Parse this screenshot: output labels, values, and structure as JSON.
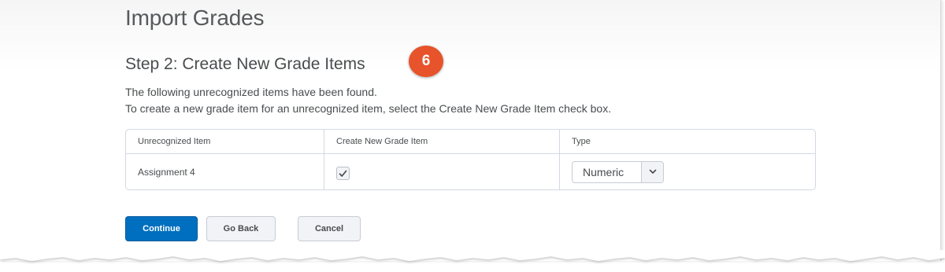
{
  "page": {
    "title": "Import Grades",
    "step_title": "Step 2: Create New Grade Items",
    "callout_number": "6",
    "description_line_1": "The following unrecognized items have been found.",
    "description_line_2": "To create a new grade item for an unrecognized item, select the Create New Grade Item check box."
  },
  "table": {
    "headers": [
      "Unrecognized Item",
      "Create New Grade Item",
      "Type"
    ],
    "rows": [
      {
        "item": "Assignment 4",
        "create_new": true,
        "type": "Numeric"
      }
    ]
  },
  "buttons": {
    "continue": "Continue",
    "go_back": "Go Back",
    "cancel": "Cancel"
  },
  "colors": {
    "primary": "#006fbf",
    "callout": "#e7532a"
  },
  "icons": {
    "checkbox": "checkmark-icon",
    "select": "chevron-down-icon"
  }
}
